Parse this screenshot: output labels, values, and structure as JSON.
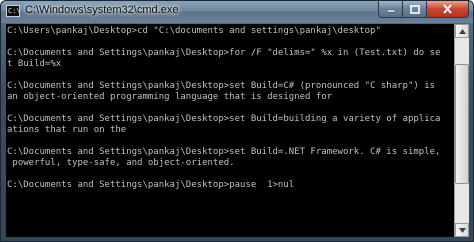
{
  "window": {
    "title": "C:\\Windows\\system32\\cmd.exe",
    "icon": "cmd-icon"
  },
  "controls": {
    "minimize_icon": "minimize-icon",
    "maximize_icon": "maximize-icon",
    "close_icon": "close-icon"
  },
  "console": {
    "lines": [
      "C:\\Users\\pankaj\\Desktop>cd \"C:\\documents and settings\\pankaj\\desktop\"",
      "",
      "C:\\Documents and Settings\\pankaj\\Desktop>for /F \"delims=\" %x in (Test.txt) do se",
      "t Build=%x",
      "",
      "C:\\Documents and Settings\\pankaj\\Desktop>set Build=C# (pronounced \"C sharp\") is",
      "an object-oriented programming language that is designed for",
      "",
      "C:\\Documents and Settings\\pankaj\\Desktop>set Build=building a variety of applica",
      "ations that run on the",
      "",
      "C:\\Documents and Settings\\pankaj\\Desktop>set Build=.NET Framework. C# is simple,",
      " powerful, type-safe, and object-oriented.",
      "",
      "C:\\Documents and Settings\\pankaj\\Desktop>pause  1>nul",
      ""
    ]
  },
  "scrollbar": {
    "up_icon": "scroll-up-arrow-icon",
    "down_icon": "scroll-down-arrow-icon"
  }
}
